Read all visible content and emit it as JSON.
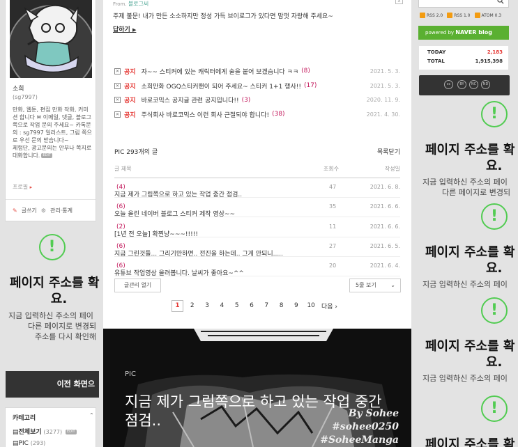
{
  "left": {
    "profile": {
      "nickname": "소희",
      "user_id": "(sg7997)",
      "intro": "만화, 웹툰, 편집 만화 작화, 커미션 합니다 ✉ 이메일, 댓글, 블로그 쪽으로 작업 문의 주세요~ 카톡문의 : sg7997  일러스트, 그림 쪽으로 우선 문의 받습니다~\n체험단, 광고문의는 안부나 쪽지로 대화합니다.",
      "edit_badge": "EDIT",
      "profile_link": "프로필",
      "write_label": "글쓰기",
      "manage_label": "관리·통계"
    },
    "warning": {
      "icon": "!",
      "title_line1": "페이지 주소를 확",
      "title_line2": "요.",
      "desc_line1": "지금 입력하신 주소의 페이",
      "desc_line2": "다른 페이지로 변경되",
      "desc_line3": "주소를 다시 확인해"
    },
    "prev_button": "이전 화면으",
    "category": {
      "title": "카테고리",
      "items": [
        {
          "label": "전체보기",
          "count": "(3277)",
          "badge": "EDIT"
        },
        {
          "label": "PIC",
          "count": "(293)"
        }
      ]
    }
  },
  "center": {
    "from_label": "From.",
    "from_name": "블로그씨",
    "from_message": "주제 불문! 내가 만든 소소하지만 정성 가득 브이로그가 있다면 맘껏 자랑해 주세요~",
    "reply_label": "답하기",
    "close_label": "x",
    "notices": [
      {
        "tag": "공지",
        "title": "자~~ 스티커에 있는 캐릭터에게 술을 붙어 보겠습니다 ㅋㅋ",
        "count": "(8)",
        "date": "2021. 5. 3."
      },
      {
        "tag": "공지",
        "title": "소희만화 OGQ스티커팬이 되어 주세요~ 스티커 1+1 행사!!",
        "count": "(17)",
        "date": "2021. 5. 3."
      },
      {
        "tag": "공지",
        "title": "바로코믹스 공지글 관련 공지입니다!!",
        "count": "(3)",
        "date": "2020. 11. 9."
      },
      {
        "tag": "공지",
        "title": "주식회사 바로코믹스 이런 회사 근절되야 합니다!",
        "count": "(38)",
        "date": "2021. 4. 30."
      }
    ],
    "list_title": "PIC 293개의 글",
    "list_close": "목록닫기",
    "columns": {
      "title": "글 제목",
      "views": "조회수",
      "date": "작성일"
    },
    "posts": [
      {
        "title": "지금 제가 그림쪽으로 하고 있는 작업 중간 점검..",
        "count": "(4)",
        "views": "47",
        "date": "2021. 6. 8."
      },
      {
        "title": "오늘 올린 네이버 블로그 스티커 제작 영상~~",
        "count": "(6)",
        "views": "35",
        "date": "2021. 6. 6."
      },
      {
        "title": "[1년 전 오늘] 확찐냥~~~!!!!!",
        "count": "(2)",
        "views": "11",
        "date": "2021. 6. 6."
      },
      {
        "title": "지금 그린것들... 그리기만하면.. 전진을 하는데.. 그게 안되니.....",
        "count": "(6)",
        "views": "27",
        "date": "2021. 6. 5."
      },
      {
        "title": "유튜브 작업영상 올려봅니다. 날씨가 좋아요~^^",
        "count": "(6)",
        "views": "20",
        "date": "2021. 6. 4."
      }
    ],
    "manage_button": "글관리 열기",
    "per_page": "5줄 보기",
    "pages": [
      "1",
      "2",
      "3",
      "4",
      "5",
      "6",
      "7",
      "8",
      "9",
      "10"
    ],
    "current_page": "1",
    "next_label": "다음",
    "hero": {
      "category": "PIC",
      "title": "지금 제가 그림쪽으로 하고 있는 작업 중간 점검..",
      "watermark1": "By Sohee",
      "watermark2": "#sohee0250",
      "watermark3": "#SoheeManga"
    }
  },
  "right": {
    "rss": [
      "RSS 2.0",
      "RSS 1.0",
      "ATOM 0.3"
    ],
    "naver_badge": {
      "prefix": "powered by",
      "brand": "NAVER blog"
    },
    "stats": {
      "today_label": "TODAY",
      "today": "2,183",
      "total_label": "TOTAL",
      "total": "1,915,398"
    },
    "cc_labels": [
      "cc",
      "BY",
      "NC",
      "ND"
    ],
    "warning": {
      "icon": "!",
      "title_line1": "페이지 주소를 확",
      "title_line2": "요.",
      "desc_line1": "지금 입력하신 주소의 페이",
      "desc_line2": "다른 페이지로 변경되"
    }
  },
  "colors": {
    "accent_red": "#e53935",
    "naver_green": "#5ab031",
    "warning_green": "#52cc52"
  }
}
